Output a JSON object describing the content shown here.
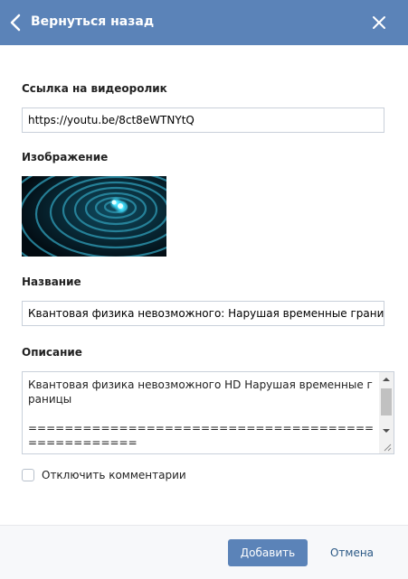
{
  "colors": {
    "header_bg": "#5b83b8",
    "primary_button": "#5b83b8",
    "link": "#2a5885",
    "footer_bg": "#f7f8fa"
  },
  "header": {
    "title": "Вернуться назад",
    "back_icon": "chevron-left-icon",
    "close_icon": "close-icon"
  },
  "form": {
    "video_link": {
      "label": "Ссылка на видеоролик",
      "value": "https://youtu.be/8ct8eWTNYtQ"
    },
    "image": {
      "label": "Изображение"
    },
    "name": {
      "label": "Название",
      "value": "Квантовая физика невозможного: Нарушая временные границы"
    },
    "description": {
      "label": "Описание",
      "value": "Квантовая физика невозможного HD Нарушая временные границы\n\n=================================================="
    },
    "disable_comments": {
      "label": "Отключить комментарии",
      "checked": false
    }
  },
  "footer": {
    "add_label": "Добавить",
    "cancel_label": "Отмена"
  }
}
